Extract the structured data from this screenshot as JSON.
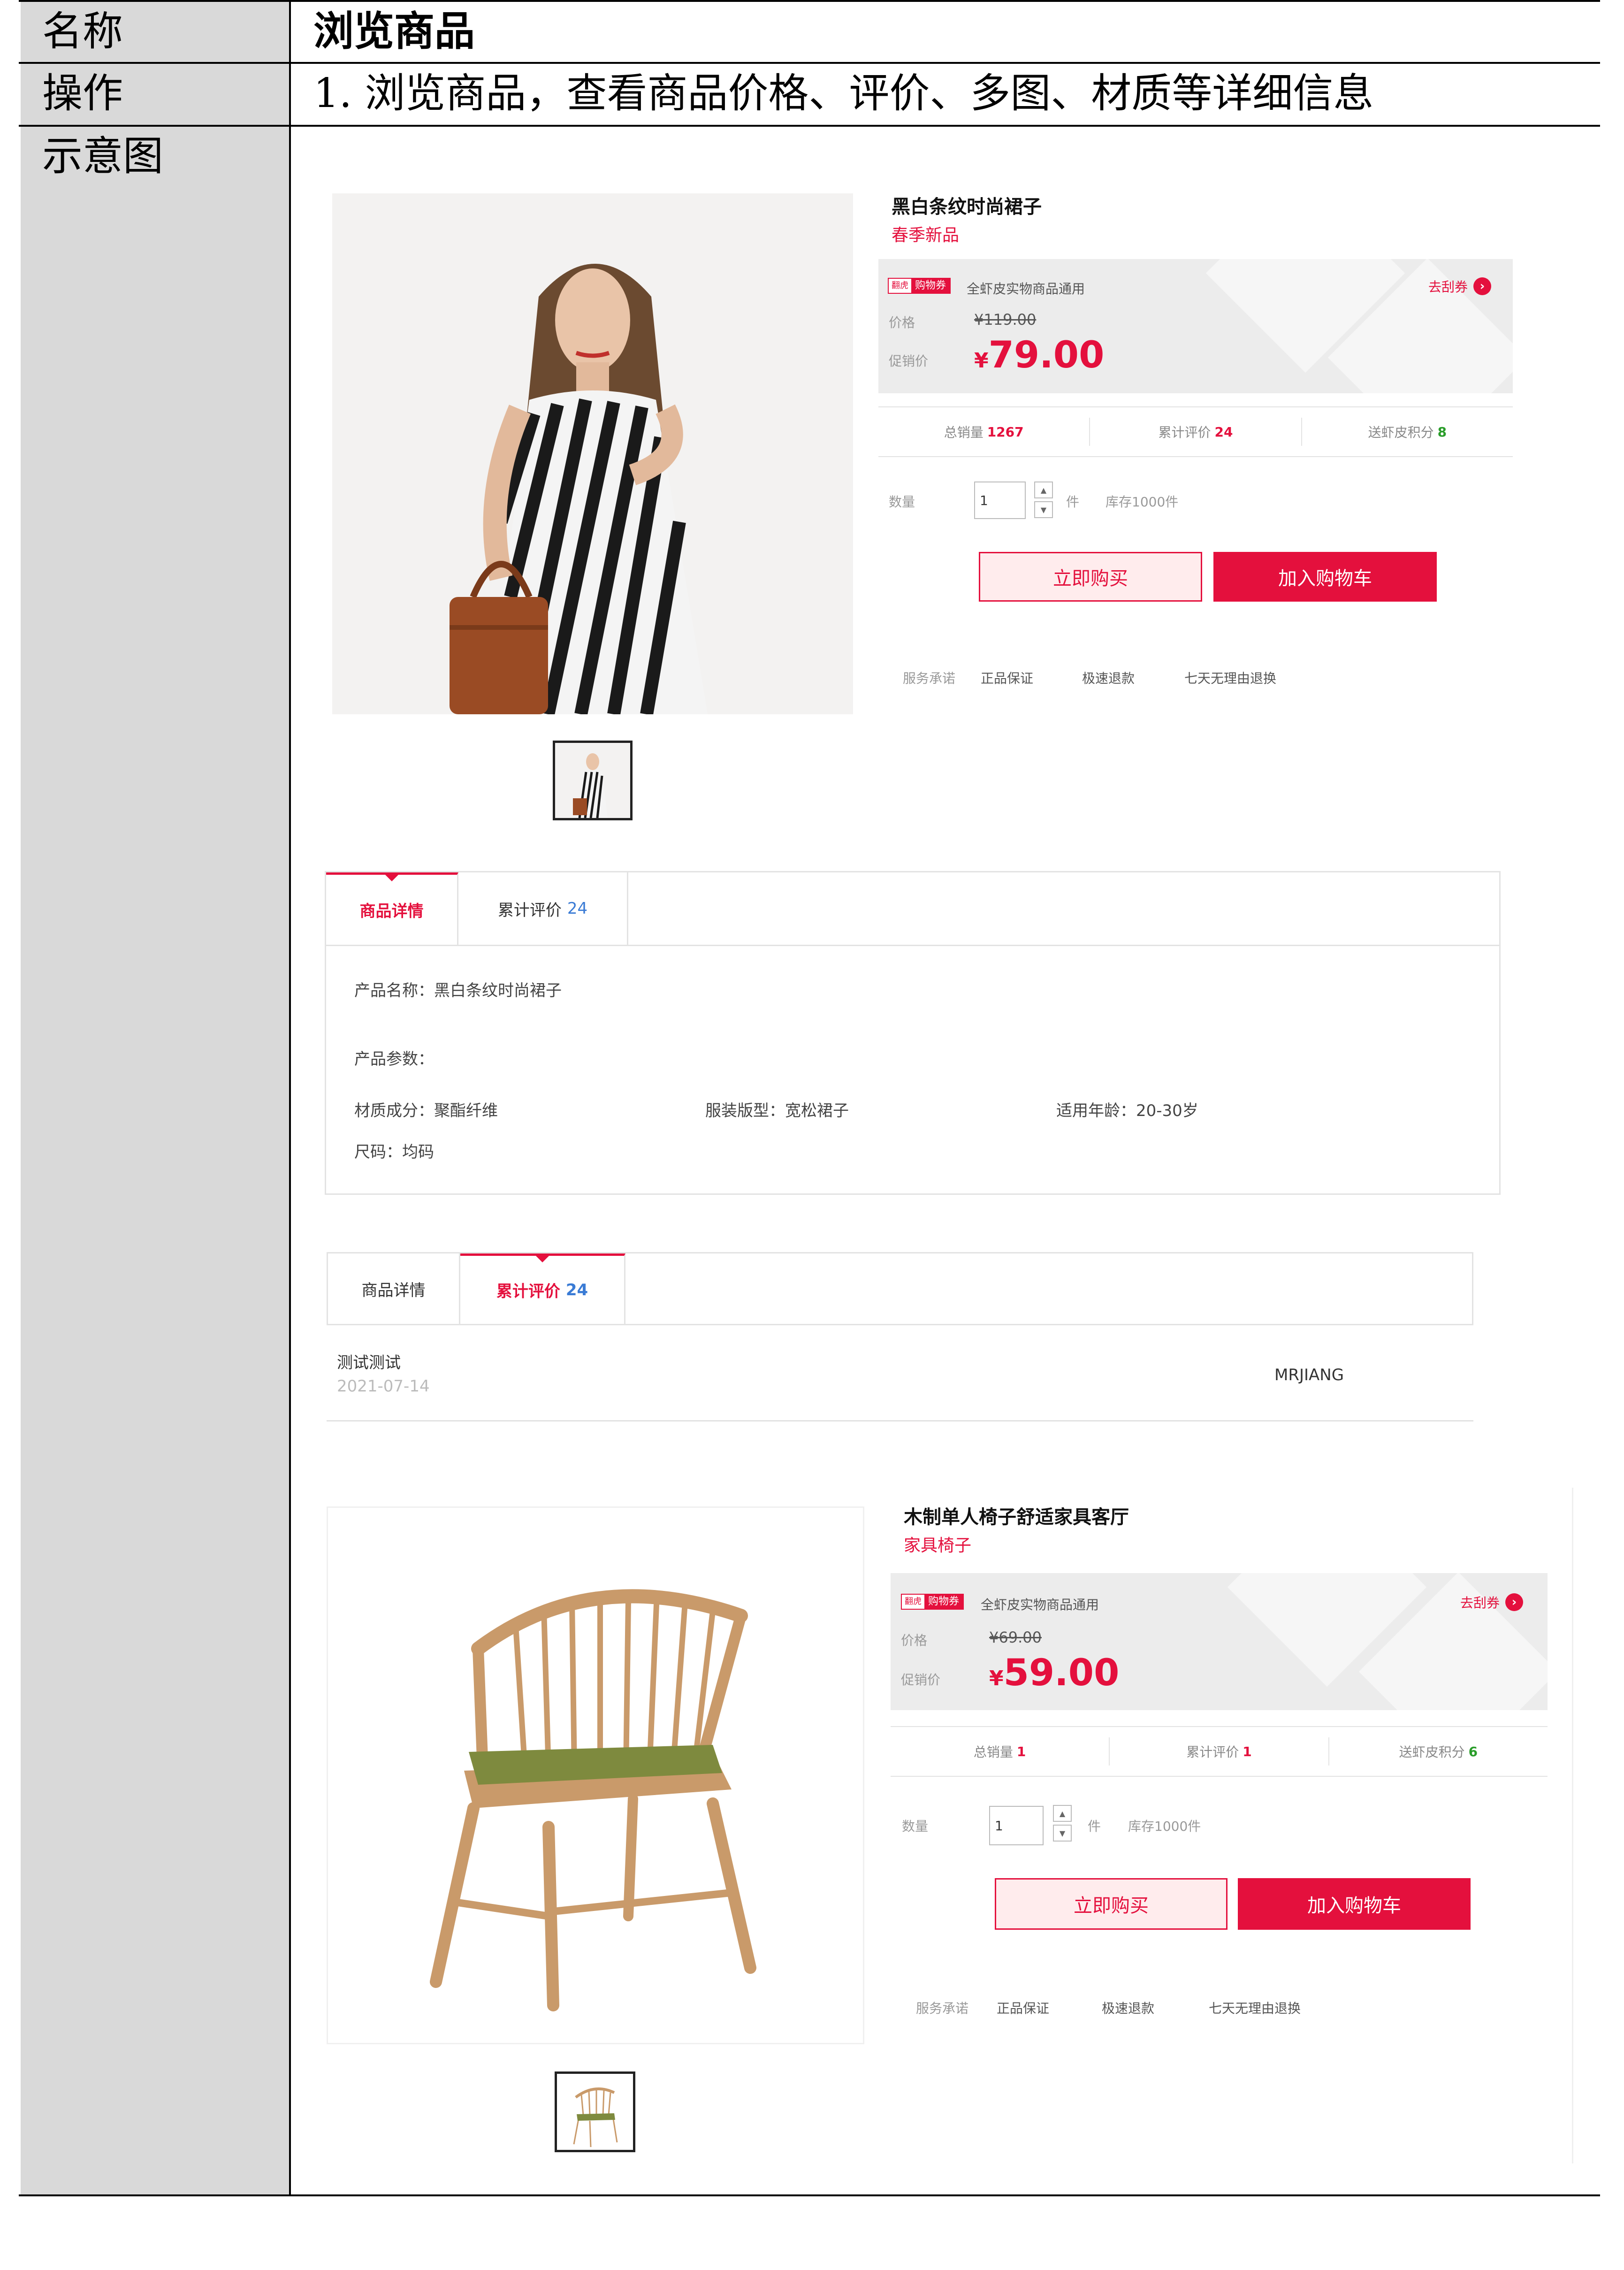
{
  "doc": {
    "row1_label": "名称",
    "row1_value": "浏览商品",
    "row2_label": "操作",
    "row2_value": "1.  浏览商品，查看商品价格、评价、多图、材质等详细信息",
    "row3_label": "示意图"
  },
  "colors": {
    "accent": "#e4103d",
    "link": "#3a7bd5",
    "green": "#2a9d2a"
  },
  "product1": {
    "title": "黑白条纹时尚裙子",
    "subtitle": "春季新品",
    "coupon_tag_a": "翻虎",
    "coupon_tag_b": "购物券",
    "coupon_text": "全虾皮实物商品通用",
    "get_coupon": "去刮券",
    "price_label": "价格",
    "old_price": "¥119.00",
    "promo_label": "促销价",
    "currency": "¥",
    "promo_price": "79.00",
    "stat_sales_label": "总销量",
    "stat_sales": "1267",
    "stat_reviews_label": "累计评价",
    "stat_reviews": "24",
    "stat_points_label": "送虾皮积分",
    "stat_points": "8",
    "qty_label": "数量",
    "qty_value": "1",
    "unit": "件",
    "stock": "库存1000件",
    "buy_now": "立即购买",
    "add_cart": "加入购物车",
    "service_label": "服务承诺",
    "service_1": "正品保证",
    "service_2": "极速退款",
    "service_3": "七天无理由退换",
    "image_icon": "woman-striped-dress-photo"
  },
  "tabs1": {
    "tab_detail": "商品详情",
    "tab_reviews": "累计评价",
    "tab_reviews_count": "24",
    "product_name": "产品名称：黑白条纹时尚裙子",
    "params_label": "产品参数：",
    "material": "材质成分：聚酯纤维",
    "style": "服装版型：宽松裙子",
    "age": "适用年龄：20-30岁",
    "size": "尺码：均码"
  },
  "tabs2": {
    "tab_detail": "商品详情",
    "tab_reviews": "累计评价",
    "tab_reviews_count": "24",
    "review_text": "测试测试",
    "review_date": "2021-07-14",
    "review_user": "MRJIANG"
  },
  "product2": {
    "title": "木制单人椅子舒适家具客厅",
    "subtitle": "家具椅子",
    "coupon_tag_a": "翻虎",
    "coupon_tag_b": "购物券",
    "coupon_text": "全虾皮实物商品通用",
    "get_coupon": "去刮券",
    "price_label": "价格",
    "old_price": "¥69.00",
    "promo_label": "促销价",
    "currency": "¥",
    "promo_price": "59.00",
    "stat_sales_label": "总销量",
    "stat_sales": "1",
    "stat_reviews_label": "累计评价",
    "stat_reviews": "1",
    "stat_points_label": "送虾皮积分",
    "stat_points": "6",
    "qty_label": "数量",
    "qty_value": "1",
    "unit": "件",
    "stock": "库存1000件",
    "buy_now": "立即购买",
    "add_cart": "加入购物车",
    "service_label": "服务承诺",
    "service_1": "正品保证",
    "service_2": "极速退款",
    "service_3": "七天无理由退换",
    "image_icon": "wooden-chair-photo"
  }
}
